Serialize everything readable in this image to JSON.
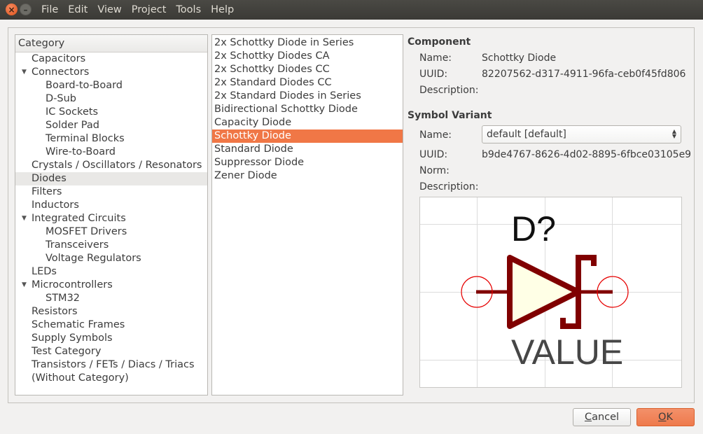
{
  "menubar": {
    "items": [
      "File",
      "Edit",
      "View",
      "Project",
      "Tools",
      "Help"
    ]
  },
  "category": {
    "header": "Category",
    "items": [
      {
        "label": "Capacitors",
        "level": 0,
        "expanded": null
      },
      {
        "label": "Connectors",
        "level": 0,
        "expanded": true
      },
      {
        "label": "Board-to-Board",
        "level": 1,
        "expanded": null
      },
      {
        "label": "D-Sub",
        "level": 1,
        "expanded": null
      },
      {
        "label": "IC Sockets",
        "level": 1,
        "expanded": null
      },
      {
        "label": "Solder Pad",
        "level": 1,
        "expanded": null
      },
      {
        "label": "Terminal Blocks",
        "level": 1,
        "expanded": null
      },
      {
        "label": "Wire-to-Board",
        "level": 1,
        "expanded": null
      },
      {
        "label": "Crystals / Oscillators / Resonators",
        "level": 0,
        "expanded": null
      },
      {
        "label": "Diodes",
        "level": 0,
        "expanded": null,
        "selected": true
      },
      {
        "label": "Filters",
        "level": 0,
        "expanded": null
      },
      {
        "label": "Inductors",
        "level": 0,
        "expanded": null
      },
      {
        "label": "Integrated Circuits",
        "level": 0,
        "expanded": true
      },
      {
        "label": "MOSFET Drivers",
        "level": 1,
        "expanded": null
      },
      {
        "label": "Transceivers",
        "level": 1,
        "expanded": null
      },
      {
        "label": "Voltage Regulators",
        "level": 1,
        "expanded": null
      },
      {
        "label": "LEDs",
        "level": 0,
        "expanded": null
      },
      {
        "label": "Microcontrollers",
        "level": 0,
        "expanded": true
      },
      {
        "label": "STM32",
        "level": 1,
        "expanded": null
      },
      {
        "label": "Resistors",
        "level": 0,
        "expanded": null
      },
      {
        "label": "Schematic Frames",
        "level": 0,
        "expanded": null
      },
      {
        "label": "Supply Symbols",
        "level": 0,
        "expanded": null
      },
      {
        "label": "Test Category",
        "level": 0,
        "expanded": null
      },
      {
        "label": "Transistors / FETs / Diacs / Triacs",
        "level": 0,
        "expanded": null
      },
      {
        "label": "(Without Category)",
        "level": 0,
        "expanded": null
      }
    ]
  },
  "components": {
    "items": [
      {
        "label": "2x Schottky Diode in Series"
      },
      {
        "label": "2x Schottky Diodes CA"
      },
      {
        "label": "2x Schottky Diodes CC"
      },
      {
        "label": "2x Standard Diodes CC"
      },
      {
        "label": "2x Standard Diodes in Series"
      },
      {
        "label": "Bidirectional Schottky Diode"
      },
      {
        "label": "Capacity Diode"
      },
      {
        "label": "Schottky Diode",
        "selected": true
      },
      {
        "label": "Standard Diode"
      },
      {
        "label": "Suppressor Diode"
      },
      {
        "label": "Zener Diode"
      }
    ]
  },
  "component": {
    "title": "Component",
    "name_label": "Name:",
    "name": "Schottky Diode",
    "uuid_label": "UUID:",
    "uuid": "82207562-d317-4911-96fa-ceb0f45fd806",
    "description_label": "Description:",
    "description": ""
  },
  "symbol_variant": {
    "title": "Symbol Variant",
    "name_label": "Name:",
    "selected": "default [default]",
    "uuid_label": "UUID:",
    "uuid": "b9de4767-8626-4d02-8895-6fbce03105e9",
    "norm_label": "Norm:",
    "norm": "",
    "description_label": "Description:",
    "description": ""
  },
  "symbol": {
    "name_text": "D?",
    "value_text": "VALUE",
    "colors": {
      "outline": "#800000",
      "fill": "#ffffe6",
      "pin_circle": "#e60000",
      "text": "#464646",
      "grid": "#dcdcdc"
    }
  },
  "buttons": {
    "cancel_pre": "",
    "cancel_mn": "C",
    "cancel_post": "ancel",
    "ok_pre": "",
    "ok_mn": "O",
    "ok_post": "K"
  },
  "colors": {
    "accent": "#f07746",
    "titlebar": "#3e3d39",
    "close": "#e95b24"
  }
}
